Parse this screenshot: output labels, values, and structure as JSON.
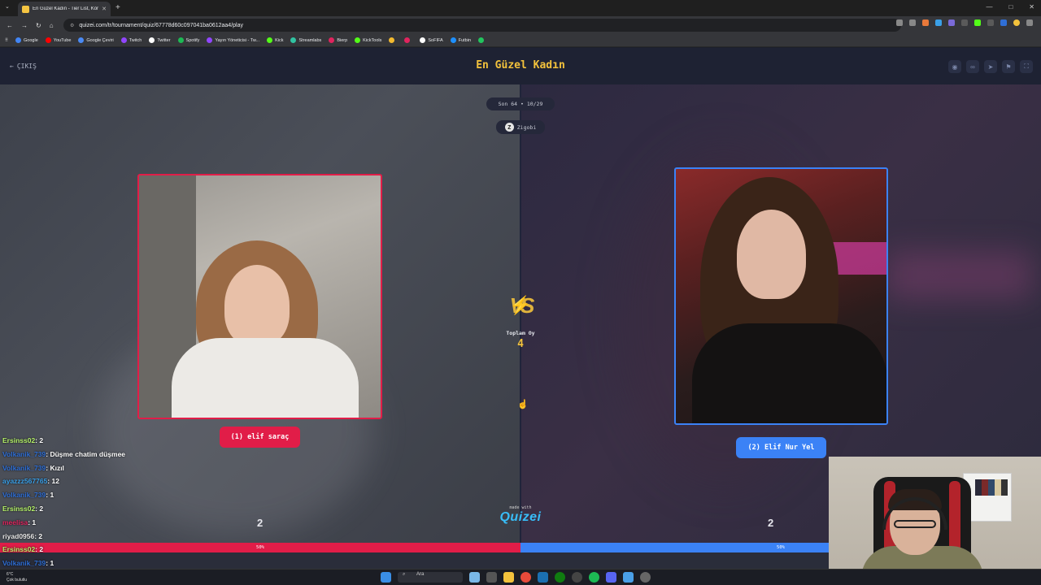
{
  "browser": {
    "tab_title": "En Güzel Kadın - Tier List, Kör S",
    "tab_close": "✕",
    "new_tab": "+",
    "url": "quizei.com/tr/tournament/quiz/67778d60c097041ba0612aa4/play",
    "bookmarks": [
      "Google",
      "YouTube",
      "Google Çeviri",
      "Twitch",
      "Twitter",
      "Spotify",
      "Yayın Yöneticisi - Tw...",
      "Kick",
      "Streamlabs",
      "Bierp",
      "KickTools",
      "",
      "",
      "SoFIFA",
      "Futbin",
      ""
    ],
    "bookmark_colors": [
      "#4285f4",
      "#ff0000",
      "#4a8af4",
      "#9146ff",
      "#ffffff",
      "#1db954",
      "#9146ff",
      "#53fc18",
      "#31c3a2",
      "#e0245e",
      "#53fc18",
      "#f3ba2f",
      "#e0245e",
      "#ffffff",
      "#1e90ff",
      "#22c55e"
    ]
  },
  "page": {
    "back_label": "ÇIKIŞ",
    "title": "En Güzel Kadın",
    "round": "Son 64 • 10/29",
    "creator": "Zigobi",
    "creator_initial": "Z",
    "left_name": "(1) elif saraç",
    "right_name": "(2) Elif Nur Yel",
    "vs_label": "VS",
    "total_label": "Toplam Oy",
    "total_votes": "4",
    "left_votes": "2",
    "right_votes": "2",
    "left_percent": "50%",
    "right_percent": "50%",
    "made_with": "made with",
    "logo": "Quizei",
    "accent_left": "#e11d48",
    "accent_right": "#3b82f6",
    "title_color": "#f3c23c"
  },
  "chat": [
    {
      "user": "Ersinss02",
      "color": "#b6f36a",
      "text": ": 2"
    },
    {
      "user": "Volkanik_739",
      "color": "#2f6fd6",
      "text": ": Düşme chatim düşmee"
    },
    {
      "user": "Volkanik_739",
      "color": "#2f6fd6",
      "text": ": Kızıl"
    },
    {
      "user": "ayazzz567765",
      "color": "#3aa0e8",
      "text": ": 12"
    },
    {
      "user": "Volkanik_739",
      "color": "#2f6fd6",
      "text": ": 1"
    },
    {
      "user": "Ersinss02",
      "color": "#b6f36a",
      "text": ": 2"
    },
    {
      "user": "meelisa",
      "color": "#e0245e",
      "text": ": 1"
    },
    {
      "user": "riyad0956",
      "color": "#e8e8e8",
      "text": ": 2"
    },
    {
      "user": "Ersinss02",
      "color": "#b6f36a",
      "text": ": 2"
    },
    {
      "user": "Volkanik_739",
      "color": "#2f6fd6",
      "text": ": 1"
    }
  ],
  "taskbar": {
    "temp": "6°C",
    "weather": "Çok bulutlu",
    "search": "Ara"
  }
}
